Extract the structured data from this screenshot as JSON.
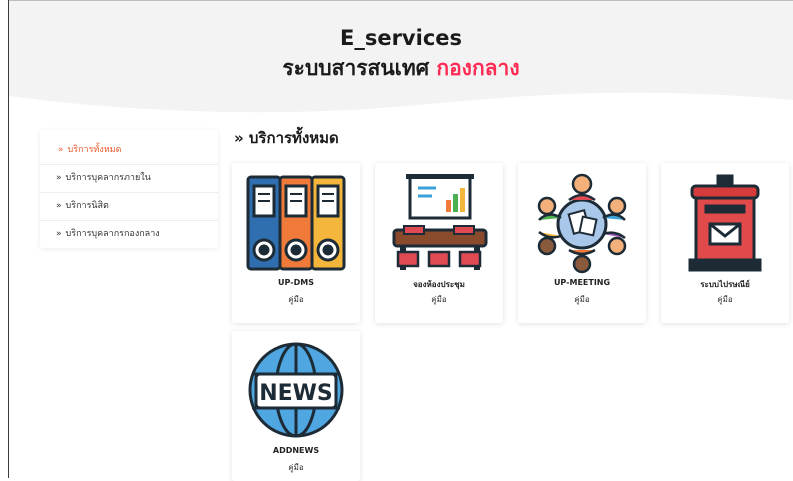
{
  "header": {
    "title": "E_services",
    "subtitle_prefix": "ระบบสารสนเทศ",
    "subtitle_accent": "กองกลาง"
  },
  "sidebar": {
    "items": [
      {
        "chev": "»",
        "label": "บริการทั้งหมด",
        "active": true
      },
      {
        "chev": "»",
        "label": "บริการบุคลากรภายใน"
      },
      {
        "chev": "»",
        "label": "บริการนิสิต"
      },
      {
        "chev": "»",
        "label": "บริการบุคลากรกองกลาง"
      }
    ]
  },
  "main": {
    "section_title": "» บริการทั้งหมด",
    "cards": [
      {
        "name": "UP-DMS",
        "manual": "คู่มือ",
        "icon": "binders-icon"
      },
      {
        "name": "จองห้องประชุม",
        "manual": "คู่มือ",
        "icon": "meeting-room-icon"
      },
      {
        "name": "UP-MEETING",
        "manual": "คู่มือ",
        "icon": "meeting-people-icon"
      },
      {
        "name": "ระบบไปรษณีย์",
        "manual": "คู่มือ",
        "icon": "mailbox-icon"
      },
      {
        "name": "ADDNEWS",
        "manual": "คู่มือ",
        "icon": "news-globe-icon"
      }
    ],
    "news_icon_text": "NEWS"
  },
  "colors": {
    "accent": "#ff2d55",
    "active_link": "#e85a2a",
    "header_bg": "#f3f3f3"
  }
}
